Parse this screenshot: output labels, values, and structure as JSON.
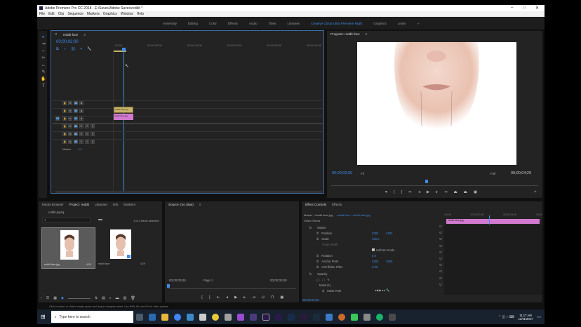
{
  "window": {
    "title": "Adobe Premiere Pro CC 2018 - E:\\Saves\\Adobe Saves\\reddit *",
    "minimize": "–",
    "maximize": "□",
    "close": "✕"
  },
  "menu": [
    "File",
    "Edit",
    "Clip",
    "Sequence",
    "Markers",
    "Graphics",
    "Window",
    "Help"
  ],
  "workspaces": {
    "items": [
      "Assembly",
      "Editing",
      "Color",
      "Effects",
      "Audio",
      "Titles",
      "Libraries",
      "Creative Cloud Ultra Premiere Right",
      "Graphics",
      "Learn"
    ],
    "active_index": 7,
    "more": "»"
  },
  "timeline": {
    "tab": "reddit face",
    "timecode": "00;00;02;00",
    "ruler": [
      ":00;00",
      "00;00;02;00",
      "00;00;04;00",
      "00;00;06;00",
      "00;00;08;00",
      "00;00;10;00"
    ],
    "tracks": [
      {
        "name": "V3",
        "type": "video"
      },
      {
        "name": "V2",
        "type": "video"
      },
      {
        "name": "V1",
        "type": "video"
      },
      {
        "name": "A1",
        "type": "audio"
      },
      {
        "name": "A2",
        "type": "audio"
      },
      {
        "name": "A3",
        "type": "audio"
      }
    ],
    "master_label": "Master",
    "master_value": "0.0",
    "clip_v_label": "reddit face.jpg",
    "clip_a_label": "reddit face.jpg"
  },
  "program": {
    "tab": "Program: reddit face",
    "timecode": "00;00;02;00",
    "zoom": "Fit",
    "resolution": "Full",
    "duration": "00;00;04;29"
  },
  "project": {
    "tabs": [
      "Media Browser",
      "Project: reddit",
      "Libraries",
      "Info",
      "Markers"
    ],
    "active_tab": 1,
    "file": "reddit.prproj",
    "status": "1 of 2 items selected",
    "items": [
      {
        "name": "reddit face.jpg",
        "duration": "4;29"
      },
      {
        "name": "reddit face",
        "duration": "4;29"
      }
    ]
  },
  "source": {
    "tab": "Source: (no clips)",
    "timecode_left": "00;00;00;00",
    "timecode_right": "00;00;00;00",
    "page": "Page 1"
  },
  "effects_panel": {
    "tabs": [
      "Effect Controls",
      "Effects"
    ],
    "active_tab": 0,
    "master": "Master * reddit face.jpg",
    "sequence": "reddit face * reddit face.jpg",
    "section": "Video Effects",
    "rows": [
      {
        "label": "Motion",
        "v1": "",
        "v2": ""
      },
      {
        "label": "Position",
        "v1": "2303",
        "v2": "2403"
      },
      {
        "label": "Scale",
        "v1": "100.0",
        "v2": ""
      },
      {
        "label": "Scale Width",
        "v1": "",
        "v2": ""
      },
      {
        "label": "Uniform Scale",
        "v1": "",
        "v2": ""
      },
      {
        "label": "Rotation",
        "v1": "0.0",
        "v2": ""
      },
      {
        "label": "Anchor Point",
        "v1": "2303",
        "v2": "2403"
      },
      {
        "label": "Anti-flicker Filter",
        "v1": "0.00",
        "v2": ""
      },
      {
        "label": "Opacity",
        "v1": "",
        "v2": ""
      },
      {
        "label": "Mask (1)",
        "v1": "",
        "v2": ""
      },
      {
        "label": "Mask Path",
        "v1": "",
        "v2": ""
      }
    ],
    "timecode": "00;00;02;00",
    "ruler": [
      ";00;00",
      "00;00;02;00",
      "00;00;04;00",
      "00;00"
    ],
    "clip_label": "reddit face.jpg"
  },
  "status_bar": "Click to select, or click in empty space and drag to marquee select. Use Shift, Alt, and Ctrl for other options.",
  "taskbar": {
    "search_placeholder": "Type here to search",
    "time": "11:17 AM",
    "date": "12/11/2017"
  },
  "colors": {
    "accent": "#3e8ce8",
    "clip_video": "#c8b46a",
    "clip_audio": "#d27ad0",
    "panel_bg": "#232323"
  }
}
